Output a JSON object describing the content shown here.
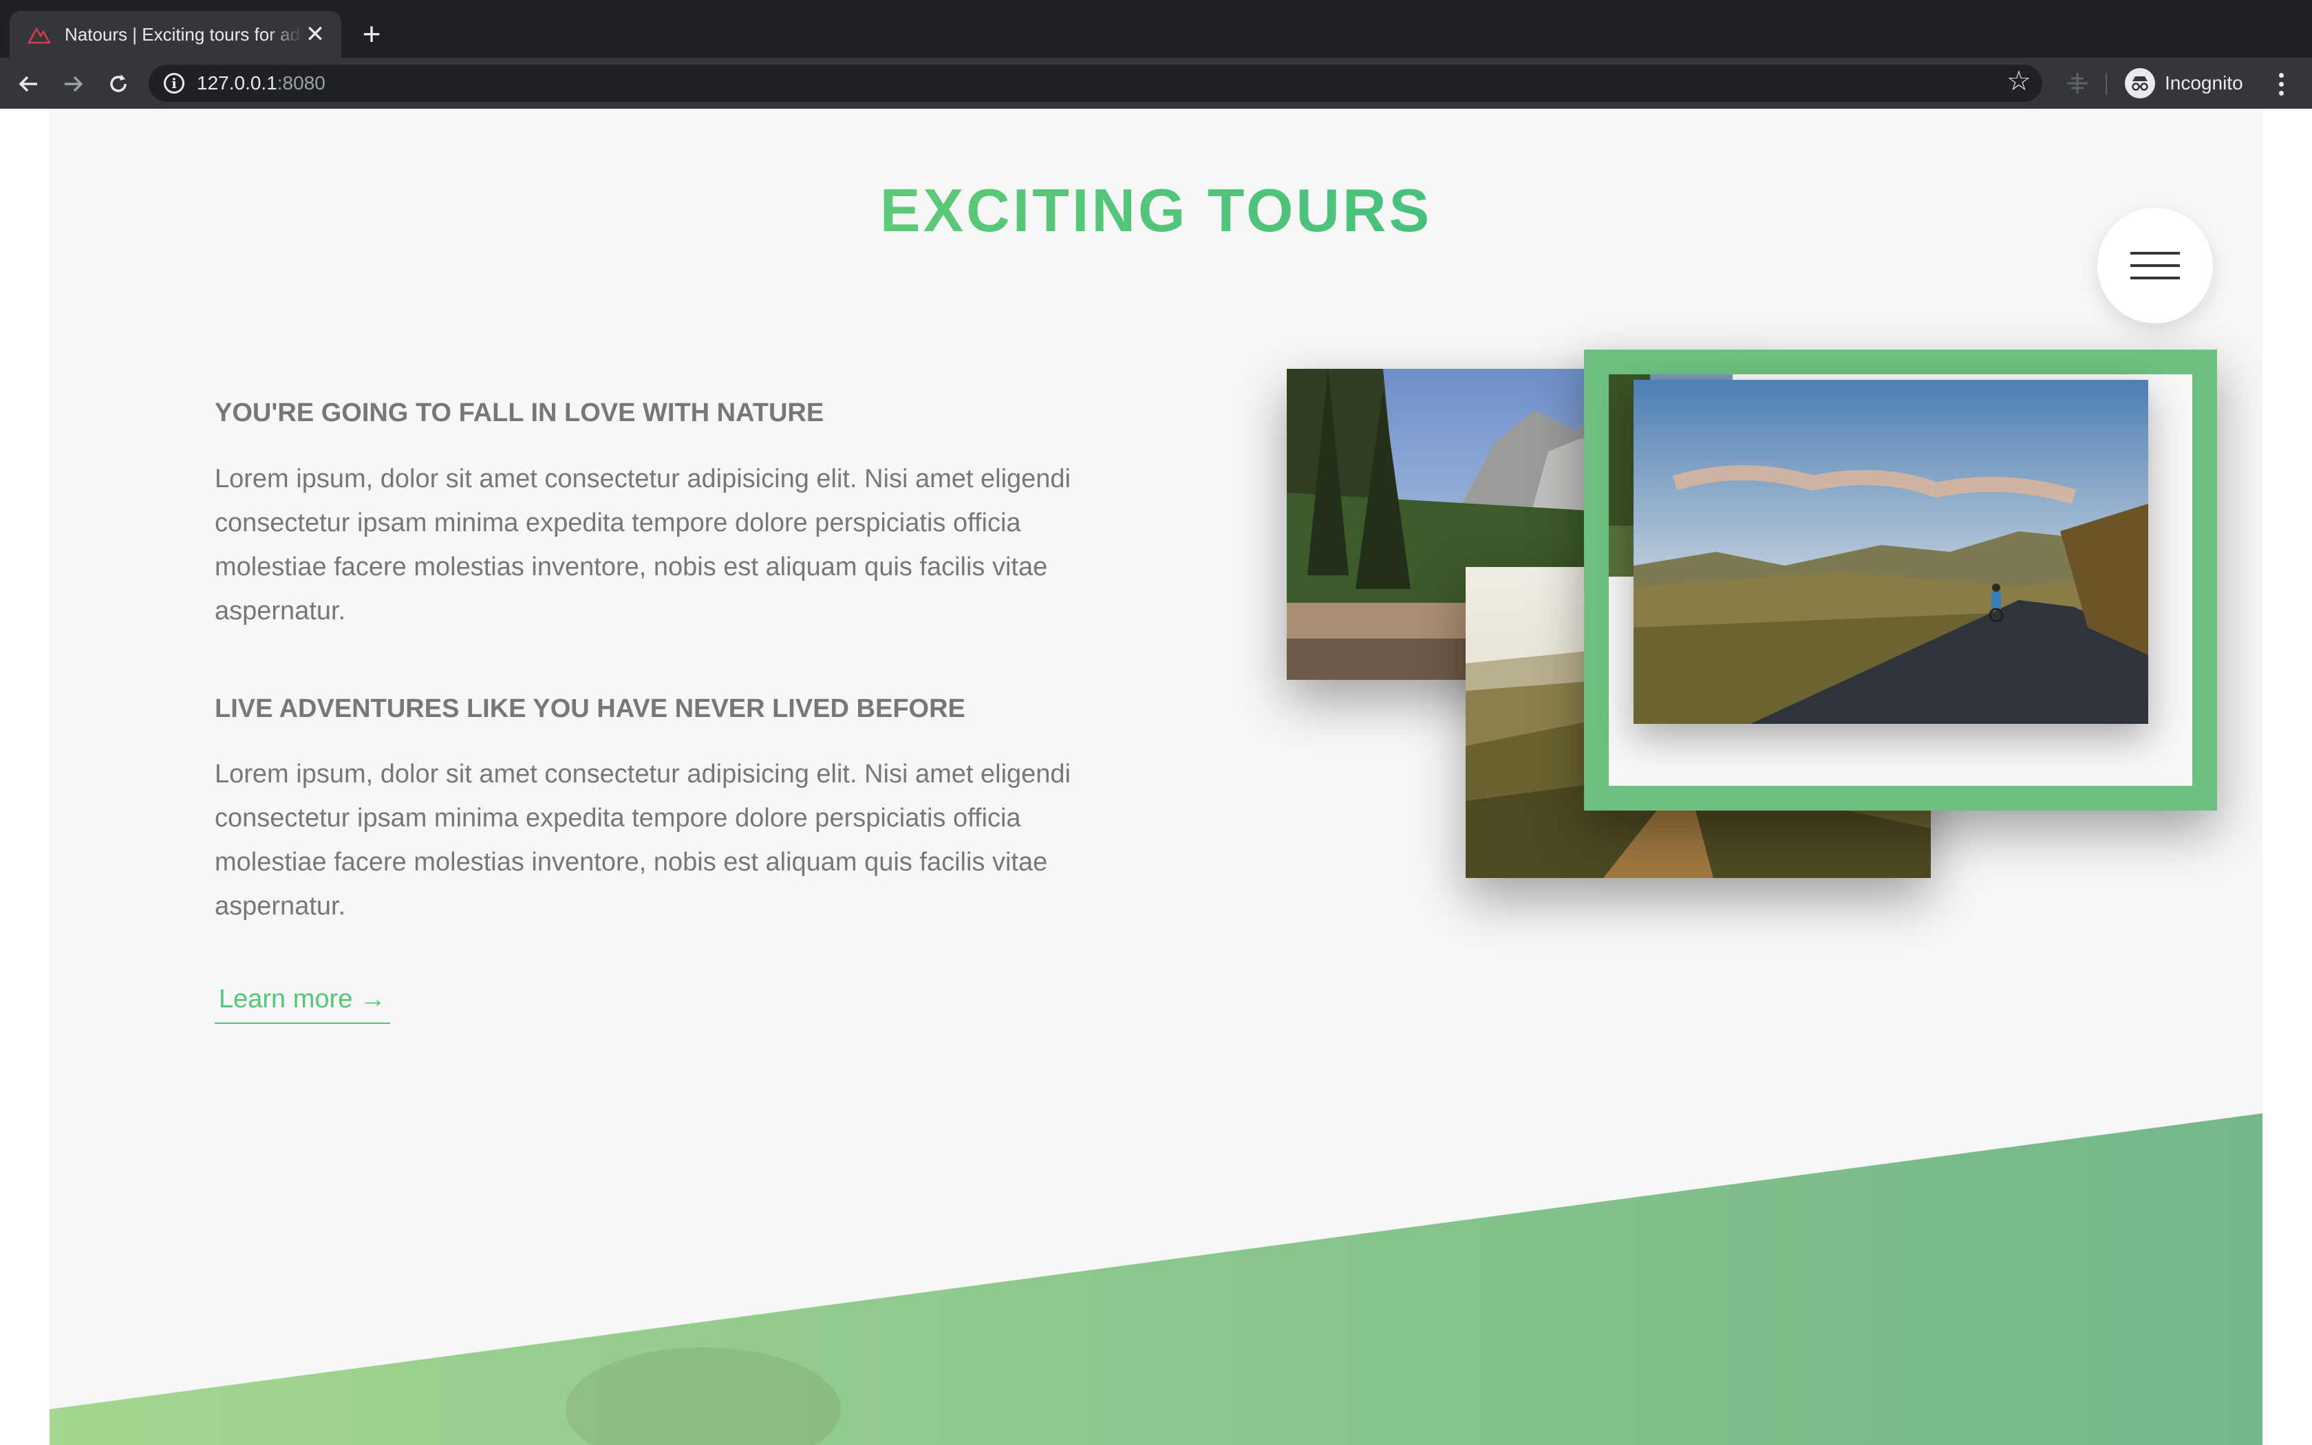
{
  "browser": {
    "tab_title": "Natours | Exciting tours for adventurous people",
    "tab_close": "✕",
    "new_tab": "+",
    "url_host": "127.0.0.1",
    "url_port": ":8080",
    "profile_label": "Incognito"
  },
  "page": {
    "section_title": "EXCITING TOURS",
    "features": [
      {
        "heading": "YOU'RE GOING TO FALL IN LOVE WITH NATURE",
        "body": "Lorem ipsum, dolor sit amet consectetur adipisicing elit. Nisi amet eligendi consectetur ipsam minima expedita tempore dolore perspiciatis officia molestiae facere molestias inventore, nobis est aliquam quis facilis vitae aspernatur."
      },
      {
        "heading": "LIVE ADVENTURES LIKE YOU HAVE NEVER LIVED BEFORE",
        "body": "Lorem ipsum, dolor sit amet consectetur adipisicing elit. Nisi amet eligendi consectetur ipsam minima expedita tempore dolore perspiciatis officia molestiae facere molestias inventore, nobis est aliquam quis facilis vitae aspernatur."
      }
    ],
    "cta_label": "Learn more →"
  },
  "colors": {
    "primary_light": "#7ed56f",
    "primary_dark": "#28b485",
    "frame_green": "#6cc17e",
    "text_grey": "#777777",
    "page_bg": "#f7f7f7"
  },
  "icons": [
    "natours-favicon",
    "close-icon",
    "plus-icon",
    "back-arrow-icon",
    "forward-arrow-icon",
    "reload-icon",
    "info-icon",
    "star-icon",
    "extension-icon",
    "incognito-icon",
    "more-vert-icon",
    "hamburger-icon"
  ]
}
